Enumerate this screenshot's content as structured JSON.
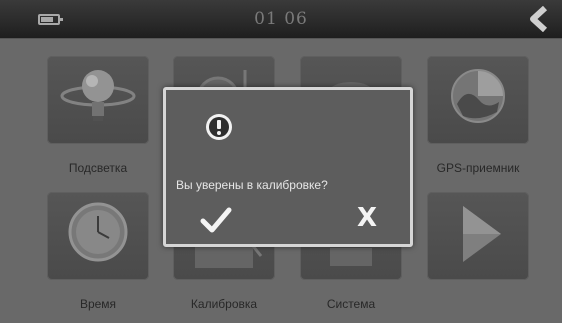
{
  "status_bar": {
    "time": "01 06",
    "battery_icon": "battery-icon",
    "back_icon": "back-chevron-icon"
  },
  "menu": {
    "items": [
      {
        "label": "Подсветка",
        "icon": "bulb-icon"
      },
      {
        "label": "",
        "icon": "volume-icon"
      },
      {
        "label": "",
        "icon": "language-icon"
      },
      {
        "label": "GPS-приемник",
        "icon": "gps-globe-icon"
      },
      {
        "label": "Время",
        "icon": "clock-icon"
      },
      {
        "label": "Калибровка",
        "icon": "calibration-icon"
      },
      {
        "label": "Система",
        "icon": "system-icon"
      },
      {
        "label": "",
        "icon": "next-arrow-icon"
      }
    ]
  },
  "dialog": {
    "message": "Вы уверены в калибровке?",
    "icon": "warning-icon",
    "confirm_icon": "checkmark-icon",
    "cancel_label": "X"
  },
  "colors": {
    "background": "#6e6e6e",
    "topbar": "#2a2a2a",
    "dialog_bg": "#5d5d5d",
    "dialog_border": "#d6d6d6",
    "label_text": "#2a2a2a",
    "dialog_text": "#e6e6e6"
  }
}
